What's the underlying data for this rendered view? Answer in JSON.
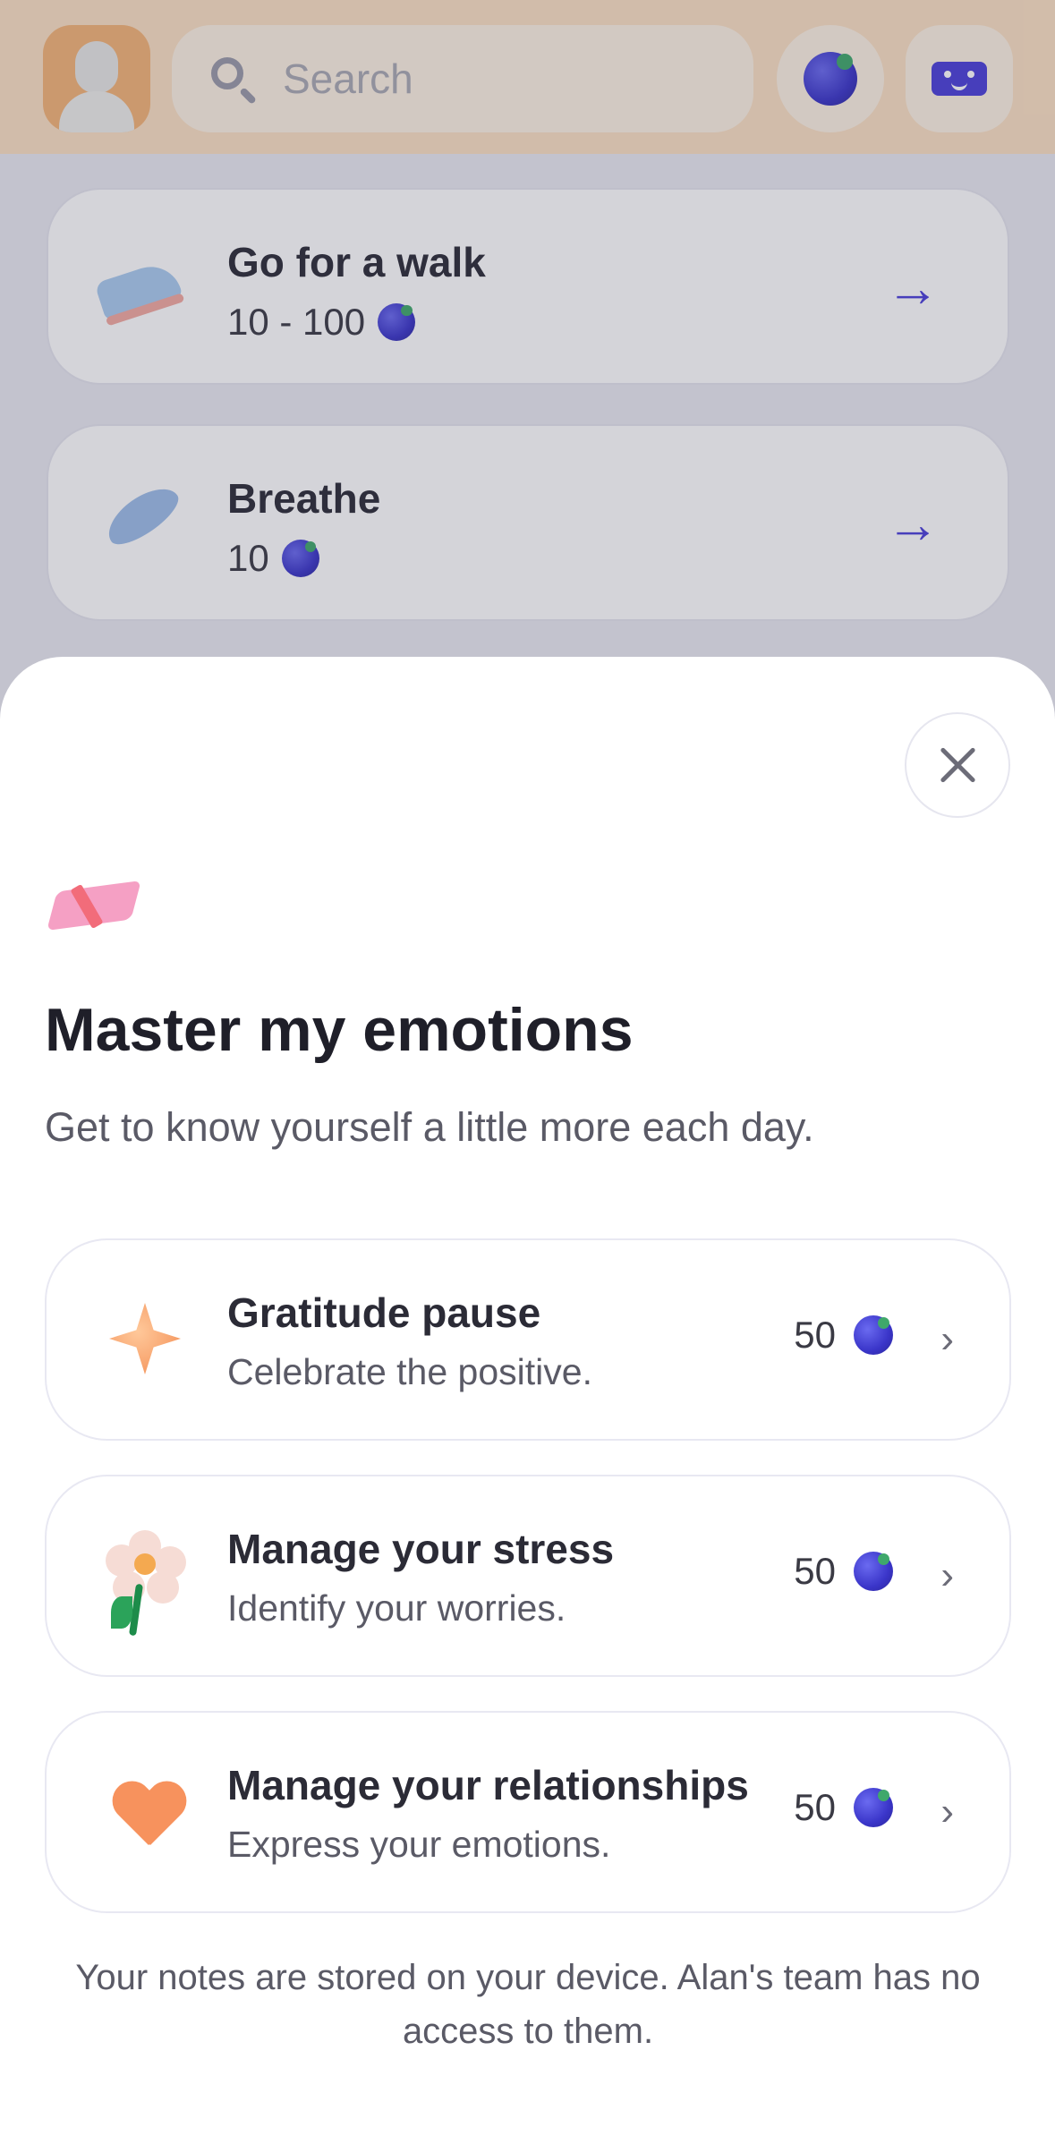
{
  "background": {
    "search": {
      "placeholder": "Search"
    },
    "activities": [
      {
        "title": "Go for a walk",
        "points": "10 - 100",
        "icon": "shoe-icon"
      },
      {
        "title": "Breathe",
        "points": "10",
        "icon": "feather-icon"
      }
    ]
  },
  "sheet": {
    "icon": "notebook-icon",
    "title": "Master my emotions",
    "subtitle": "Get to know yourself a little more each day.",
    "items": [
      {
        "title": "Gratitude pause",
        "description": "Celebrate the positive.",
        "points": "50",
        "icon": "sparkle-icon"
      },
      {
        "title": "Manage your stress",
        "description": "Identify your worries.",
        "points": "50",
        "icon": "flower-icon"
      },
      {
        "title": "Manage your relationships",
        "description": "Express your emotions.",
        "points": "50",
        "icon": "heart-icon"
      }
    ],
    "footer": "Your notes are stored on your device. Alan's team has no access to them."
  },
  "colors": {
    "accent": "#4b3fd9",
    "topbar": "#fce1c3",
    "berry": "#3a35c9"
  }
}
